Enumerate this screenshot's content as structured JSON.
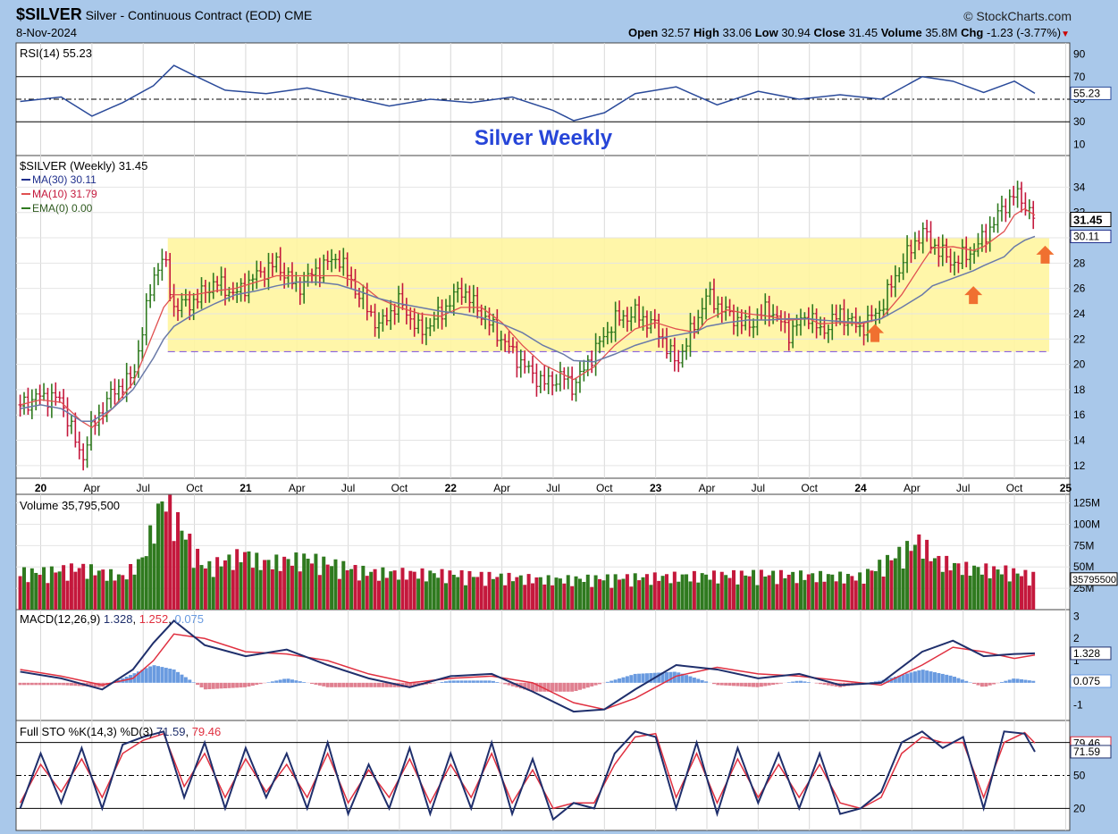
{
  "header": {
    "symbol": "$SILVER",
    "description": "Silver - Continuous Contract (EOD)",
    "exchange": "CME",
    "date": "8-Nov-2024",
    "brand": "StockCharts.com",
    "open_label": "Open",
    "open": "32.57",
    "high_label": "High",
    "high": "33.06",
    "low_label": "Low",
    "low": "30.94",
    "close_label": "Close",
    "close": "31.45",
    "volume_label": "Volume",
    "volume": "35.8M",
    "chg_label": "Chg",
    "chg": "-1.23 (-3.77%)"
  },
  "colors": {
    "up": "#2f7a1f",
    "down": "#c4183c",
    "ma30": "#1f2f8c",
    "ma10": "#e05050",
    "band": "#fff5a0",
    "title": "#2645d8",
    "macd": "#1f2f6c",
    "signal": "#e03040",
    "hist": "#6a9be0",
    "panel_bg": "#ffffff",
    "arrow": "#f07030"
  },
  "chart_data": [
    {
      "type": "line",
      "panel": "RSI",
      "legend": "RSI(14) 55.23",
      "current": "55.23",
      "ylim": [
        0,
        100
      ],
      "yticks": [
        "90",
        "70",
        "50",
        "30",
        "10"
      ],
      "levels": [
        70,
        50,
        30
      ],
      "x": [
        2019.9,
        2020.1,
        2020.25,
        2020.4,
        2020.55,
        2020.65,
        2020.75,
        2020.9,
        2021.1,
        2021.3,
        2021.5,
        2021.7,
        2021.9,
        2022.1,
        2022.3,
        2022.5,
        2022.6,
        2022.75,
        2022.9,
        2023.1,
        2023.3,
        2023.5,
        2023.7,
        2023.9,
        2024.1,
        2024.3,
        2024.45,
        2024.6,
        2024.75,
        2024.85
      ],
      "values": [
        48,
        52,
        35,
        47,
        62,
        80,
        71,
        58,
        55,
        60,
        52,
        44,
        50,
        47,
        52,
        40,
        31,
        38,
        55,
        61,
        45,
        57,
        50,
        54,
        50,
        70,
        66,
        56,
        66,
        55.23
      ]
    },
    {
      "type": "bar",
      "panel": "Price",
      "title": "Silver Weekly",
      "legend": "$SILVER (Weekly) 31.45",
      "ma30_label": "MA(30) 30.11",
      "ma10_label": "MA(10) 31.79",
      "ema_label": "EMA(0) 0.00",
      "last_price": "31.45",
      "ma30_value": "30.11",
      "ylim": [
        11,
        36.5
      ],
      "yticks": [
        "34",
        "32",
        "30",
        "28",
        "26",
        "24",
        "22",
        "20",
        "18",
        "16",
        "14",
        "12"
      ],
      "range_band": [
        21,
        30
      ],
      "x_ticks": [
        "20",
        "Apr",
        "Jul",
        "Oct",
        "21",
        "Apr",
        "Jul",
        "Oct",
        "22",
        "Apr",
        "Jul",
        "Oct",
        "23",
        "Apr",
        "Jul",
        "Oct",
        "24",
        "Apr",
        "Jul",
        "Oct",
        "25"
      ],
      "x": [
        2019.9,
        2020.0,
        2020.1,
        2020.2,
        2020.25,
        2020.35,
        2020.45,
        2020.55,
        2020.6,
        2020.65,
        2020.75,
        2020.85,
        2020.95,
        2021.05,
        2021.15,
        2021.25,
        2021.35,
        2021.45,
        2021.55,
        2021.65,
        2021.75,
        2021.85,
        2021.95,
        2022.05,
        2022.15,
        2022.25,
        2022.35,
        2022.45,
        2022.55,
        2022.6,
        2022.7,
        2022.8,
        2022.9,
        2023.0,
        2023.1,
        2023.2,
        2023.25,
        2023.35,
        2023.45,
        2023.55,
        2023.65,
        2023.75,
        2023.8,
        2023.9,
        2024.0,
        2024.1,
        2024.2,
        2024.3,
        2024.35,
        2024.45,
        2024.55,
        2024.6,
        2024.7,
        2024.75,
        2024.8,
        2024.85
      ],
      "close": [
        16.8,
        17.5,
        17.2,
        12.5,
        15.0,
        17.8,
        19.0,
        27.0,
        28.5,
        24.5,
        25.0,
        26.5,
        25.5,
        27.0,
        28.0,
        26.0,
        27.5,
        28.5,
        25.5,
        23.0,
        25.0,
        22.5,
        24.0,
        26.0,
        24.0,
        22.0,
        20.0,
        18.5,
        19.0,
        18.2,
        21.0,
        23.5,
        24.0,
        23.0,
        20.0,
        23.5,
        25.5,
        24.0,
        23.0,
        24.5,
        22.5,
        24.0,
        22.5,
        24.0,
        22.8,
        24.5,
        28.0,
        30.5,
        29.5,
        28.0,
        29.0,
        30.0,
        32.5,
        33.5,
        32.7,
        31.45
      ],
      "ma30": [
        16.5,
        16.8,
        16.5,
        15.5,
        15.5,
        16.5,
        18.0,
        20.5,
        22.0,
        23.0,
        24.0,
        24.8,
        25.5,
        25.8,
        26.2,
        26.5,
        26.5,
        26.3,
        25.8,
        25.2,
        24.8,
        24.5,
        24.2,
        24.0,
        23.7,
        23.2,
        22.5,
        21.5,
        20.8,
        20.3,
        20.2,
        20.8,
        21.5,
        22.0,
        22.3,
        22.6,
        23.0,
        23.3,
        23.5,
        23.5,
        23.6,
        23.6,
        23.5,
        23.4,
        23.3,
        23.6,
        24.5,
        25.5,
        26.2,
        26.8,
        27.4,
        27.8,
        28.5,
        29.3,
        29.8,
        30.11
      ],
      "ma10": [
        16.8,
        17.2,
        17.0,
        15.5,
        15.0,
        16.5,
        18.5,
        22.5,
        24.5,
        25.5,
        25.5,
        25.8,
        26.0,
        26.5,
        27.0,
        27.0,
        27.0,
        27.0,
        26.5,
        25.2,
        24.5,
        24.0,
        23.8,
        24.5,
        24.5,
        23.3,
        21.5,
        20.0,
        19.2,
        18.8,
        19.8,
        21.5,
        22.8,
        23.3,
        22.8,
        22.5,
        23.5,
        24.3,
        24.0,
        23.8,
        23.5,
        23.6,
        23.2,
        23.3,
        23.2,
        23.6,
        25.5,
        28.0,
        29.2,
        29.3,
        29.0,
        29.3,
        30.5,
        31.8,
        32.3,
        31.79
      ]
    },
    {
      "type": "bar",
      "panel": "Volume",
      "legend": "Volume 35,795,500",
      "current": "35795500",
      "current_label": "35795500",
      "ylim": [
        0,
        135
      ],
      "yticks": [
        "125M",
        "100M",
        "75M",
        "50M",
        "25M"
      ],
      "x": [
        2020.0,
        2020.2,
        2020.4,
        2020.5,
        2020.55,
        2020.6,
        2020.8,
        2021.0,
        2021.08,
        2021.3,
        2021.6,
        2022.0,
        2022.5,
        2023.0,
        2023.5,
        2024.0,
        2024.3,
        2024.35,
        2024.5,
        2024.7,
        2024.85
      ],
      "values": [
        40,
        45,
        35,
        55,
        90,
        120,
        45,
        60,
        50,
        55,
        40,
        38,
        32,
        35,
        38,
        35,
        75,
        55,
        45,
        42,
        35.8
      ]
    },
    {
      "type": "line",
      "panel": "MACD",
      "legend_name": "MACD(12,26,9)",
      "macd_value": "1.328",
      "signal_value": "1.252",
      "hist_value": "0.075",
      "ylim": [
        -1.7,
        3.3
      ],
      "yticks": [
        "3",
        "2",
        "1",
        "-1"
      ],
      "x": [
        2019.9,
        2020.1,
        2020.3,
        2020.45,
        2020.55,
        2020.65,
        2020.8,
        2021.0,
        2021.2,
        2021.4,
        2021.6,
        2021.8,
        2022.0,
        2022.2,
        2022.4,
        2022.6,
        2022.75,
        2022.9,
        2023.1,
        2023.3,
        2023.5,
        2023.7,
        2023.9,
        2024.1,
        2024.3,
        2024.45,
        2024.6,
        2024.75,
        2024.85
      ],
      "macd": [
        0.5,
        0.2,
        -0.3,
        0.6,
        1.8,
        2.8,
        1.7,
        1.2,
        1.5,
        0.8,
        0.2,
        -0.2,
        0.3,
        0.4,
        -0.4,
        -1.3,
        -1.2,
        -0.3,
        0.8,
        0.6,
        0.2,
        0.4,
        -0.1,
        0.0,
        1.4,
        1.9,
        1.2,
        1.3,
        1.328
      ],
      "signal": [
        0.6,
        0.3,
        -0.1,
        0.2,
        1.0,
        2.2,
        2.0,
        1.4,
        1.3,
        1.0,
        0.4,
        0.0,
        0.2,
        0.3,
        0.0,
        -0.9,
        -1.2,
        -0.7,
        0.3,
        0.7,
        0.4,
        0.3,
        0.1,
        -0.1,
        0.8,
        1.6,
        1.4,
        1.1,
        1.252
      ]
    },
    {
      "type": "line",
      "panel": "Full STO",
      "legend_name": "Full STO %K(14,3) %D(3)",
      "k_value": "71.59",
      "d_value": "79.46",
      "ylim": [
        0,
        100
      ],
      "yticks": [
        "50",
        "20"
      ],
      "levels": [
        80,
        50,
        20
      ],
      "x": [
        2019.9,
        2020.0,
        2020.1,
        2020.2,
        2020.3,
        2020.4,
        2020.5,
        2020.6,
        2020.7,
        2020.8,
        2020.9,
        2021.0,
        2021.1,
        2021.2,
        2021.3,
        2021.4,
        2021.5,
        2021.6,
        2021.7,
        2021.8,
        2021.9,
        2022.0,
        2022.1,
        2022.2,
        2022.3,
        2022.4,
        2022.5,
        2022.6,
        2022.7,
        2022.8,
        2022.9,
        2023.0,
        2023.1,
        2023.2,
        2023.3,
        2023.4,
        2023.5,
        2023.6,
        2023.7,
        2023.8,
        2023.9,
        2024.0,
        2024.1,
        2024.2,
        2024.3,
        2024.4,
        2024.5,
        2024.6,
        2024.7,
        2024.8,
        2024.85
      ],
      "k": [
        20,
        70,
        25,
        75,
        20,
        78,
        85,
        90,
        30,
        80,
        20,
        75,
        30,
        70,
        20,
        80,
        15,
        60,
        20,
        75,
        15,
        70,
        20,
        80,
        15,
        65,
        10,
        25,
        20,
        70,
        90,
        85,
        20,
        80,
        15,
        75,
        25,
        70,
        20,
        70,
        15,
        20,
        35,
        80,
        90,
        75,
        85,
        20,
        90,
        88,
        71.59
      ],
      "d": [
        25,
        60,
        35,
        65,
        30,
        70,
        82,
        88,
        40,
        70,
        30,
        65,
        35,
        60,
        30,
        70,
        25,
        55,
        30,
        65,
        25,
        60,
        30,
        70,
        25,
        55,
        20,
        25,
        25,
        60,
        85,
        88,
        30,
        70,
        25,
        65,
        30,
        60,
        30,
        60,
        25,
        20,
        30,
        70,
        85,
        80,
        80,
        30,
        80,
        89,
        79.46
      ]
    }
  ]
}
